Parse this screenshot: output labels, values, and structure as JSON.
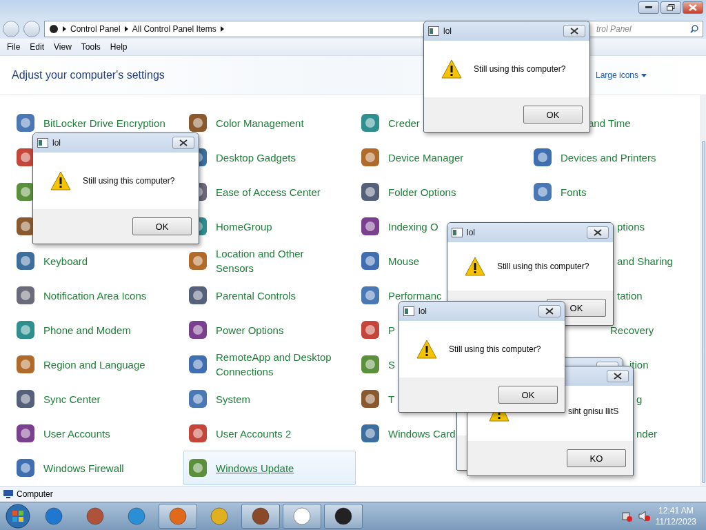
{
  "address_bar": {
    "breadcrumbs": [
      "Control Panel",
      "All Control Panel Items"
    ]
  },
  "search": {
    "placeholder": "trol Panel"
  },
  "menu": [
    "File",
    "Edit",
    "View",
    "Tools",
    "Help"
  ],
  "header": {
    "title": "Adjust your computer's settings",
    "view_by": "Large icons"
  },
  "columns": [
    [
      {
        "label": "BitLocker Drive Encryption",
        "kind": "full",
        "hovered": false
      },
      {
        "kind": "hidden",
        "hovered": false
      },
      {
        "kind": "hidden",
        "hovered": false
      },
      {
        "kind": "hidden",
        "hovered": false
      },
      {
        "label": "Keyboard",
        "kind": "full",
        "hovered": false
      },
      {
        "label": "Notification Area Icons",
        "kind": "full",
        "hovered": false
      },
      {
        "label": "Phone and Modem",
        "kind": "full",
        "hovered": false
      },
      {
        "label": "Region and Language",
        "kind": "full",
        "hovered": false
      },
      {
        "label": "Sync Center",
        "kind": "full",
        "hovered": false
      },
      {
        "label": "User Accounts",
        "kind": "full",
        "hovered": false
      },
      {
        "label": "Windows Firewall",
        "kind": "full",
        "hovered": false
      }
    ],
    [
      {
        "label": "Color Management",
        "kind": "full",
        "hovered": false
      },
      {
        "label": "Desktop Gadgets",
        "kind": "full",
        "hovered": false
      },
      {
        "label": "Ease of Access Center",
        "kind": "full",
        "hovered": false
      },
      {
        "label": "HomeGroup",
        "kind": "full",
        "hovered": false
      },
      {
        "label": "Location and Other Sensors",
        "kind": "full",
        "hovered": false
      },
      {
        "label": "Parental Controls",
        "kind": "full",
        "hovered": false
      },
      {
        "label": "Power Options",
        "kind": "full",
        "hovered": false
      },
      {
        "label": "RemoteApp and Desktop Connections",
        "kind": "full",
        "hovered": false
      },
      {
        "label": "System",
        "kind": "full",
        "hovered": false
      },
      {
        "label": "User Accounts 2",
        "kind": "full",
        "hovered": false
      },
      {
        "label": "Windows Update",
        "kind": "full",
        "hovered": true
      }
    ],
    [
      {
        "label": "Creder",
        "kind": "full",
        "hovered": false
      },
      {
        "label": "Device Manager",
        "kind": "full",
        "hovered": false
      },
      {
        "label": "Folder Options",
        "kind": "full",
        "hovered": false
      },
      {
        "label": "Indexing O",
        "kind": "full",
        "hovered": false
      },
      {
        "label": "Mouse",
        "kind": "full",
        "hovered": false
      },
      {
        "label": "Performanc",
        "kind": "full",
        "hovered": false
      },
      {
        "label": "P",
        "kind": "full",
        "hovered": false
      },
      {
        "label": "S",
        "kind": "full",
        "hovered": false
      },
      {
        "label": "T",
        "kind": "full",
        "hovered": false
      },
      {
        "label": "Windows Card",
        "kind": "full",
        "hovered": false
      },
      {
        "kind": "hidden",
        "hovered": false
      }
    ],
    [
      {
        "label": "and Time",
        "kind": "cut",
        "hovered": false
      },
      {
        "label": "Devices and Printers",
        "kind": "full",
        "hovered": false
      },
      {
        "label": "Fonts",
        "kind": "full",
        "hovered": false
      },
      {
        "label": "ptions",
        "kind": "cut",
        "hovered": false
      },
      {
        "label": "and Sharing",
        "kind": "cut",
        "hovered": false
      },
      {
        "label": "tation",
        "kind": "cut",
        "hovered": false
      },
      {
        "label": "Recovery",
        "kind": "cut",
        "hovered": false
      },
      {
        "label": "ition",
        "kind": "cut",
        "hovered": false
      },
      {
        "label": "g",
        "kind": "cut",
        "hovered": false
      },
      {
        "label": "nder",
        "kind": "cut",
        "hovered": false
      },
      {
        "kind": "hidden",
        "hovered": false
      }
    ]
  ],
  "status_bar": {
    "text": "Computer"
  },
  "taskbar": {
    "apps": [
      {
        "active": false
      },
      {
        "active": false
      },
      {
        "active": false
      },
      {
        "active": true
      },
      {
        "active": false
      },
      {
        "active": true
      },
      {
        "active": true
      },
      {
        "active": true
      }
    ]
  },
  "clock": {
    "time": "12:41 AM",
    "date": "11/12/2023"
  },
  "dialogs": [
    {
      "kind": "normal",
      "title": "lol",
      "message": "Still using this computer?",
      "button": "OK"
    },
    {
      "kind": "normal",
      "title": "lol",
      "message": "Still using this computer?",
      "button": "OK"
    },
    {
      "kind": "normal",
      "title": "lol",
      "message": "Still using this computer?",
      "button": "OK"
    },
    {
      "kind": "blank"
    },
    {
      "kind": "reversed",
      "message": "siht gnisu llitS",
      "button": "KO"
    },
    {
      "kind": "normal",
      "title": "lol",
      "message": "Still using this computer?",
      "button": "OK"
    }
  ]
}
